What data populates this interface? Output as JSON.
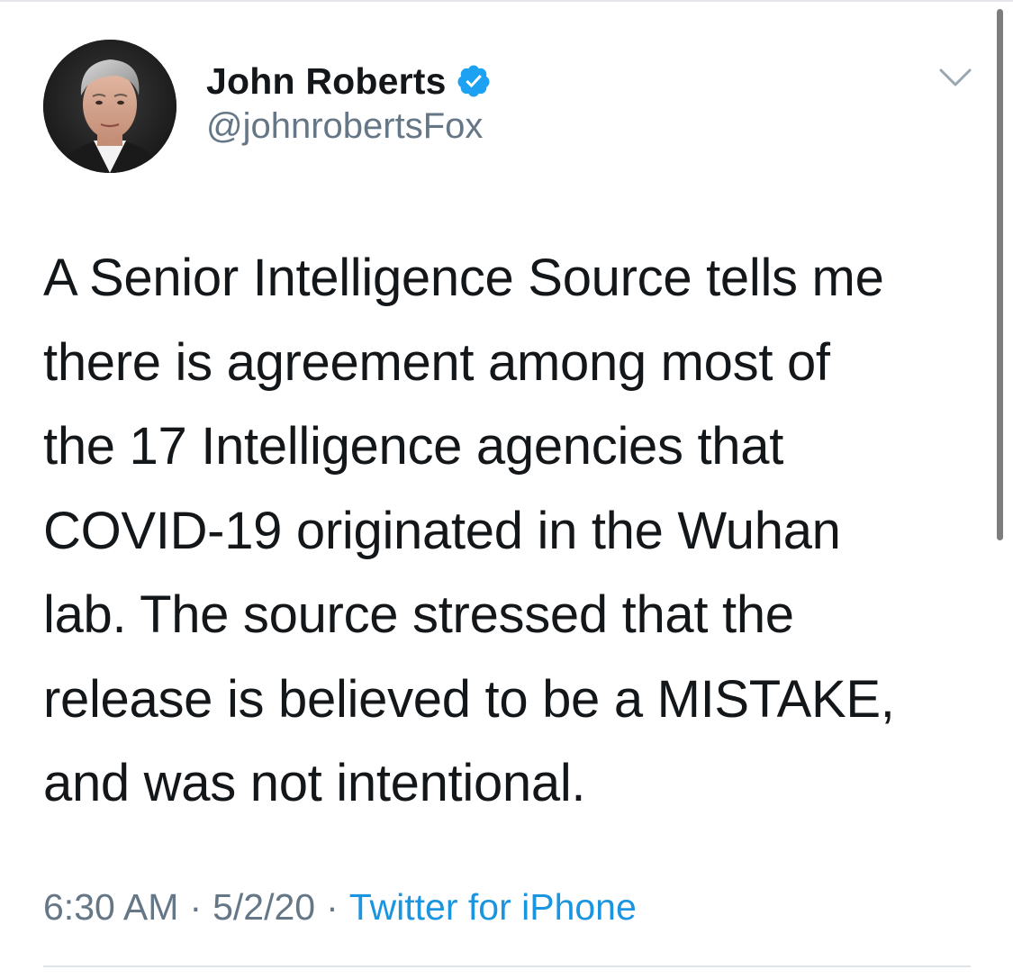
{
  "author": {
    "display_name": "John Roberts",
    "handle": "@johnrobertsFox",
    "verified": true,
    "avatar_icon": "profile-photo"
  },
  "tweet": {
    "text": "A Senior Intelligence Source tells me\nthere is agreement among most of\nthe 17 Intelligence agencies that\nCOVID-19 originated in the Wuhan\nlab. The source stressed that the\nrelease is believed to be a MISTAKE,\nand was not intentional."
  },
  "meta": {
    "time": "6:30 AM",
    "separator": "·",
    "date": "5/2/20",
    "source": "Twitter for iPhone"
  },
  "icons": {
    "verified": "verified-badge-icon",
    "menu": "chevron-down-icon"
  },
  "colors": {
    "text_primary": "#14171a",
    "text_secondary": "#657786",
    "link": "#1b95e0",
    "verified": "#1da1f2"
  }
}
